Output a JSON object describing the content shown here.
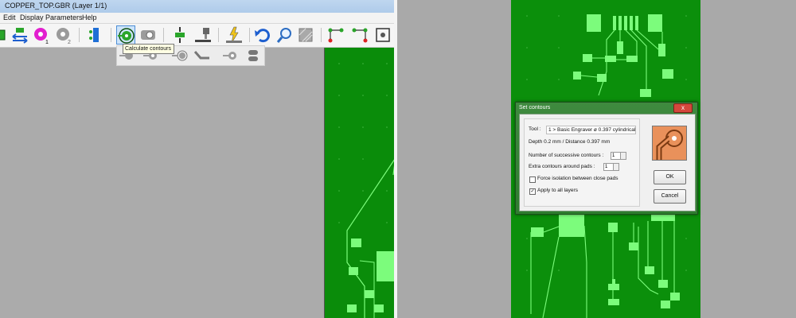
{
  "app": {
    "title": "COPPER_TOP.GBR   (Layer 1/1)",
    "menu": [
      "Edit",
      "Display",
      "Parameters",
      "Help"
    ]
  },
  "toolbar": {
    "tooltip": "Calculate contours",
    "layer_marker_1": "1",
    "layer_marker_2": "2"
  },
  "dialog": {
    "title": "Set contours",
    "close_label": "x",
    "tool_label": "Tool :",
    "tool_value": "1 > Basic Engraver   ø 0.397   cylindrical",
    "depth_text": "Depth 0.2 mm  /  Distance 0.397 mm",
    "successive_label": "Number of successive contours :",
    "successive_value": "1",
    "extra_label": "Extra contours around pads :",
    "extra_value": "1",
    "force_label": "Force isolation between close pads",
    "force_checked": "",
    "apply_label": "Apply to all layers",
    "apply_checked": "✓",
    "ok_label": "OK",
    "cancel_label": "Cancel"
  },
  "colors": {
    "pcb_green": "#0b8f0b",
    "pad_green": "#7cfc7c",
    "logo_orange": "#e9915b",
    "active_blue": "#4e8ed6"
  },
  "icons": [
    "layer-toggle-icon",
    "units-swap-icon",
    "pad-1-icon",
    "pad-2-icon",
    "drill-icon",
    "calculate-contours-icon",
    "remove-contours-icon",
    "mill-icon",
    "engraver-icon",
    "lightning-icon",
    "undo-icon",
    "magnifier-icon",
    "texture-icon",
    "nodes-icon",
    "nodes-2-icon",
    "settings-icon"
  ]
}
